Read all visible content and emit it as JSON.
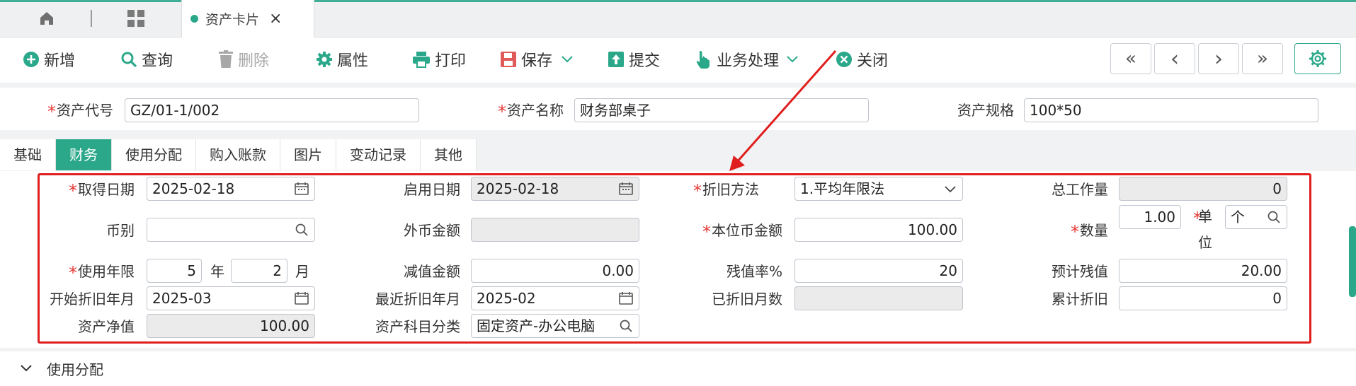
{
  "tabbar": {
    "tab_label": "资产卡片",
    "close": "×"
  },
  "toolbar": {
    "add": "新增",
    "query": "查询",
    "delete": "删除",
    "attr": "属性",
    "print": "打印",
    "save": "保存",
    "submit": "提交",
    "business": "业务处理",
    "close": "关闭"
  },
  "nav": {
    "first": "«",
    "prev": "‹",
    "next": "›",
    "last": "»"
  },
  "header": {
    "code_label": "资产代号",
    "code_value": "GZ/01-1/002",
    "name_label": "资产名称",
    "name_value": "财务部桌子",
    "spec_label": "资产规格",
    "spec_value": "100*50"
  },
  "tabs": [
    "基础",
    "财务",
    "使用分配",
    "购入账款",
    "图片",
    "变动记录",
    "其他"
  ],
  "active_tab": "财务",
  "finance": {
    "acquire_date_label": "取得日期",
    "acquire_date": "2025-02-18",
    "enable_date_label": "启用日期",
    "enable_date": "2025-02-18",
    "dep_method_label": "折旧方法",
    "dep_method": "1.平均年限法",
    "total_work_label": "总工作量",
    "total_work": "0",
    "currency_label": "币别",
    "currency": "",
    "foreign_amount_label": "外币金额",
    "foreign_amount": "",
    "local_amount_label": "本位币金额",
    "local_amount": "100.00",
    "qty_label": "数量",
    "qty": "1.00",
    "unit_label_1": "单",
    "unit_label_2": "位",
    "unit": "个",
    "life_label": "使用年限",
    "life_years": "5",
    "year_unit": "年",
    "life_months": "2",
    "month_unit": "月",
    "impair_label": "减值金额",
    "impair": "0.00",
    "residual_rate_label": "残值率%",
    "residual_rate": "20",
    "est_residual_label": "预计残值",
    "est_residual": "20.00",
    "start_dep_label": "开始折旧年月",
    "start_dep": "2025-03",
    "recent_dep_label": "最近折旧年月",
    "recent_dep": "2025-02",
    "dep_months_label": "已折旧月数",
    "dep_months": "",
    "acc_dep_label": "累计折旧",
    "acc_dep": "0",
    "net_value_label": "资产净值",
    "net_value": "100.00",
    "category_label": "资产科目分类",
    "category": "固定资产-办公电脑"
  },
  "section": {
    "title": "使用分配"
  },
  "colors": {
    "accent": "#2aa889",
    "highlight": "#e01e1e",
    "required": "#e53935"
  }
}
